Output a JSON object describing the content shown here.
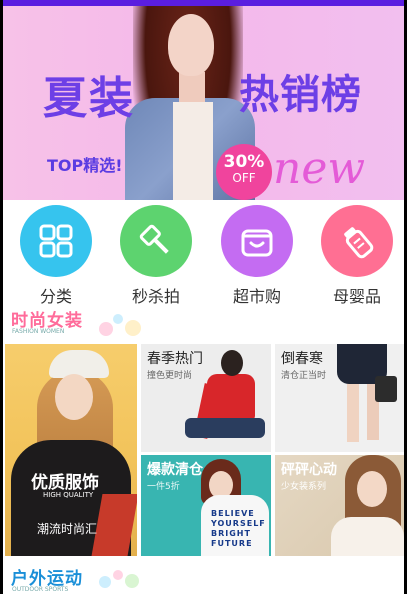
{
  "banner": {
    "title_left": "夏装",
    "title_right": "热销榜",
    "tagline": "TOP精选!",
    "discount": "30%",
    "discount_label": "OFF",
    "decor_word": "new"
  },
  "categories": [
    {
      "label": "分类",
      "icon": "grid-icon",
      "color": "#36c4ee"
    },
    {
      "label": "秒杀拍",
      "icon": "gavel-icon",
      "color": "#5dd36f"
    },
    {
      "label": "超市购",
      "icon": "shop-icon",
      "color": "#c46cf2"
    },
    {
      "label": "母婴品",
      "icon": "baby-bottle-icon",
      "color": "#ff6f93"
    }
  ],
  "section_fashion": {
    "title": "时尚女装",
    "subtitle": "FASHION WOMEN",
    "color": "#ff6b9a"
  },
  "tiles": {
    "big": {
      "title": "优质服饰",
      "subtitle": "HIGH QUALITY",
      "caption": "潮流时尚汇"
    },
    "spring_hot": {
      "title": "春季热门",
      "subtitle": "撞色更时尚"
    },
    "early_spring": {
      "title": "倒春寒",
      "subtitle": "清仓正当时"
    },
    "clearance": {
      "title": "爆款清仓",
      "subtitle": "一件5折",
      "print": "BELIEVE YOURSELF BRIGHT FUTURE"
    },
    "heart": {
      "title": "砰砰心动",
      "subtitle": "少女装系列"
    }
  },
  "section_outdoor": {
    "title": "户外运动",
    "subtitle": "OUTDOOR SPORTS",
    "color": "#1a8fd8"
  }
}
